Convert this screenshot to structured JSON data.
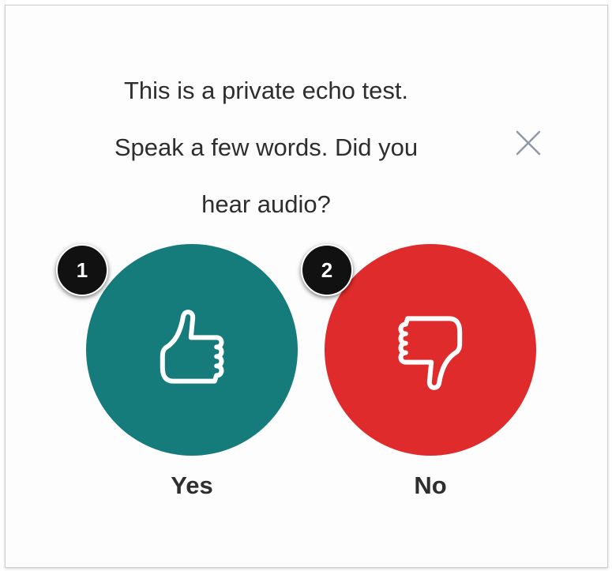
{
  "dialog": {
    "message_lines": [
      "This is a private echo test.",
      "Speak a few words. Did you",
      "hear audio?"
    ],
    "close_icon": "close-icon",
    "yes": {
      "label": "Yes",
      "icon": "thumbs-up-icon",
      "color": "#167b7b"
    },
    "no": {
      "label": "No",
      "icon": "thumbs-down-icon",
      "color": "#df2b2b"
    }
  },
  "annotations": {
    "badges": [
      "1",
      "2"
    ],
    "badge_color": "#111111"
  }
}
